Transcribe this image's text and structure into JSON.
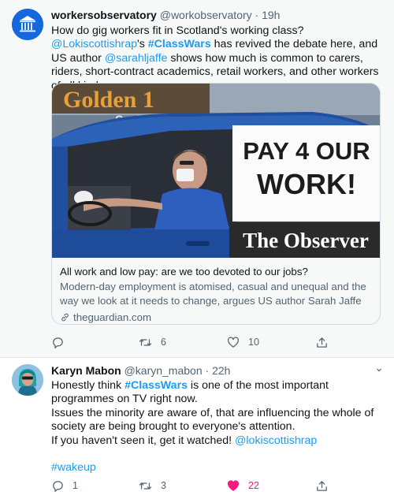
{
  "tweets": [
    {
      "display_name": "workersobservatory",
      "handle": "@workobservatory",
      "time": "· 19h",
      "text": {
        "p1": "How do gig workers fit in Scotland's working class? ",
        "m1": "@Lokiscottishrap",
        "p2": "'s ",
        "h1": "#ClassWars",
        "p3": " has revived the debate here, and US author ",
        "m2": "@sarahljaffe",
        "p4": " shows how much is common to carers, riders, short-contract academics, retail workers, and other workers of all kinds"
      },
      "card": {
        "image": {
          "sign_line1": "PAY 4 OUR",
          "sign_line2": "WORK!",
          "watermark": "The Observer",
          "storefront": "Golden 1",
          "storefront_sub": "Credit"
        },
        "title": "All work and low pay: are we too devoted to our jobs?",
        "description": "Modern-day employment is atomised, casual and unequal and the way we look at it needs to change, argues US author Sarah Jaffe",
        "domain": "theguardian.com"
      },
      "actions": {
        "replies": "",
        "retweets": "6",
        "likes": "10"
      }
    },
    {
      "display_name": "Karyn Mabon",
      "handle": "@karyn_mabon",
      "time": "· 22h",
      "text": {
        "p1": "Honestly think ",
        "h1": "#ClassWars",
        "p2": " is one of the most important programmes on TV right now.",
        "p3": "Issues the minority are aware of, that are influencing the whole of society are being brought to everyone's attention.",
        "p4": "If you haven't seen it, get it watched! ",
        "m1": "@lokiscottishrap",
        "h2": "#wakeup"
      },
      "actions": {
        "replies": "1",
        "retweets": "3",
        "likes": "22"
      }
    }
  ],
  "colors": {
    "accent": "#1d9bf0",
    "like_active": "#f91880",
    "secondary_text": "#536471"
  },
  "icons": [
    "avatar-logo-icon",
    "reply-icon",
    "retweet-icon",
    "like-icon",
    "share-icon",
    "link-icon",
    "more-icon"
  ]
}
